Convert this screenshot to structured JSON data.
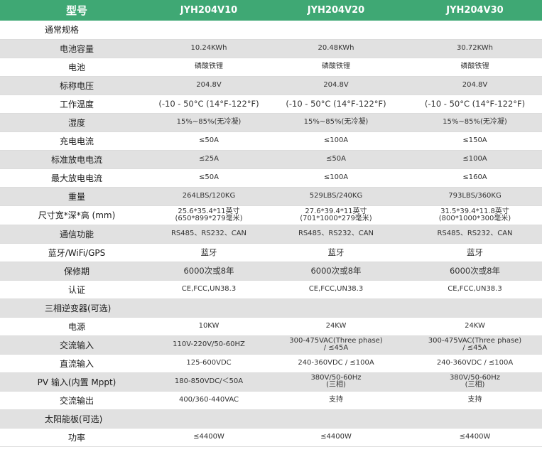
{
  "header": {
    "model_label": "型号",
    "models": [
      "JYH204V10",
      "JYH204V20",
      "JYH204V30"
    ]
  },
  "rows": [
    {
      "section": "通常规格"
    },
    {
      "label": "电池容量",
      "values": [
        [
          "10.24KWh"
        ],
        [
          "20.48KWh"
        ],
        [
          "30.72KWh"
        ]
      ]
    },
    {
      "label": "电池",
      "values": [
        [
          "磷酸铁锂"
        ],
        [
          "磷酸铁锂"
        ],
        [
          "磷酸铁锂"
        ]
      ]
    },
    {
      "label": "标称电压",
      "values": [
        [
          "204.8V"
        ],
        [
          "204.8V"
        ],
        [
          "204.8V"
        ]
      ]
    },
    {
      "label": "工作温度",
      "values": [
        [
          "(-10 - 50°C (14°F-122°F)"
        ],
        [
          "(-10 - 50°C (14°F-122°F)"
        ],
        [
          "(-10 - 50°C (14°F-122°F)"
        ]
      ],
      "big": true
    },
    {
      "label": "湿度",
      "values": [
        [
          "15%~85%(无冷凝)"
        ],
        [
          "15%~85%(无冷凝)"
        ],
        [
          "15%~85%(无冷凝)"
        ]
      ]
    },
    {
      "label": "充电电流",
      "values": [
        [
          "≤50A"
        ],
        [
          "≤100A"
        ],
        [
          "≤150A"
        ]
      ]
    },
    {
      "label": "标准放电电流",
      "values": [
        [
          "≤25A"
        ],
        [
          "≤50A"
        ],
        [
          "≤100A"
        ]
      ]
    },
    {
      "label": "最大放电电流",
      "values": [
        [
          "≤50A"
        ],
        [
          "≤100A"
        ],
        [
          "≤160A"
        ]
      ]
    },
    {
      "label": "重量",
      "values": [
        [
          "264LBS/120KG"
        ],
        [
          "529LBS/240KG"
        ],
        [
          "793LBS/360KG"
        ]
      ]
    },
    {
      "label": "尺寸宽*深*高 (mm)",
      "values": [
        [
          "25.6*35.4*11英寸",
          "(650*899*279毫米)"
        ],
        [
          "27.6*39.4*11英寸",
          "(701*1000*279毫米)"
        ],
        [
          "31.5*39.4*11.8英寸",
          "(800*1000*300毫米)"
        ]
      ]
    },
    {
      "label": "通信功能",
      "values": [
        [
          "RS485、RS232、CAN"
        ],
        [
          "RS485、RS232、CAN"
        ],
        [
          "RS485、RS232、CAN"
        ]
      ]
    },
    {
      "label": "蓝牙/WiFi/GPS",
      "values": [
        [
          "蓝牙"
        ],
        [
          "蓝牙"
        ],
        [
          "蓝牙"
        ]
      ],
      "big": true
    },
    {
      "label": "保修期",
      "values": [
        [
          "6000次或8年"
        ],
        [
          "6000次或8年"
        ],
        [
          "6000次或8年"
        ]
      ],
      "big": true
    },
    {
      "label": "认证",
      "values": [
        [
          "CE,FCC,UN38.3"
        ],
        [
          "CE,FCC,UN38.3"
        ],
        [
          "CE,FCC,UN38.3"
        ]
      ]
    },
    {
      "section": "三相逆变器(可选)"
    },
    {
      "label": "电源",
      "values": [
        [
          "10KW"
        ],
        [
          "24KW"
        ],
        [
          "24KW"
        ]
      ]
    },
    {
      "label": "交流输入",
      "values": [
        [
          "110V-220V/50-60HZ"
        ],
        [
          "300-475VAC(Three phase)",
          "/ ≤45A"
        ],
        [
          "300-475VAC(Three phase)",
          "/ ≤45A"
        ]
      ]
    },
    {
      "label": "直流输入",
      "values": [
        [
          "125-600VDC"
        ],
        [
          "240-360VDC / ≤100A"
        ],
        [
          "240-360VDC / ≤100A"
        ]
      ]
    },
    {
      "label": "PV 输入(内置 Mppt)",
      "values": [
        [
          "180-850VDC/＜50A"
        ],
        [
          "380V/50-60Hz",
          "(三相)"
        ],
        [
          "380V/50-60Hz",
          "(三相)"
        ]
      ]
    },
    {
      "label": "交流输出",
      "values": [
        [
          "400/360-440VAC"
        ],
        [
          "支持"
        ],
        [
          "支持"
        ]
      ]
    },
    {
      "section": "太阳能板(可选)"
    },
    {
      "label": "功率",
      "values": [
        [
          "≤4400W"
        ],
        [
          "≤4400W"
        ],
        [
          "≤4400W"
        ]
      ]
    }
  ]
}
